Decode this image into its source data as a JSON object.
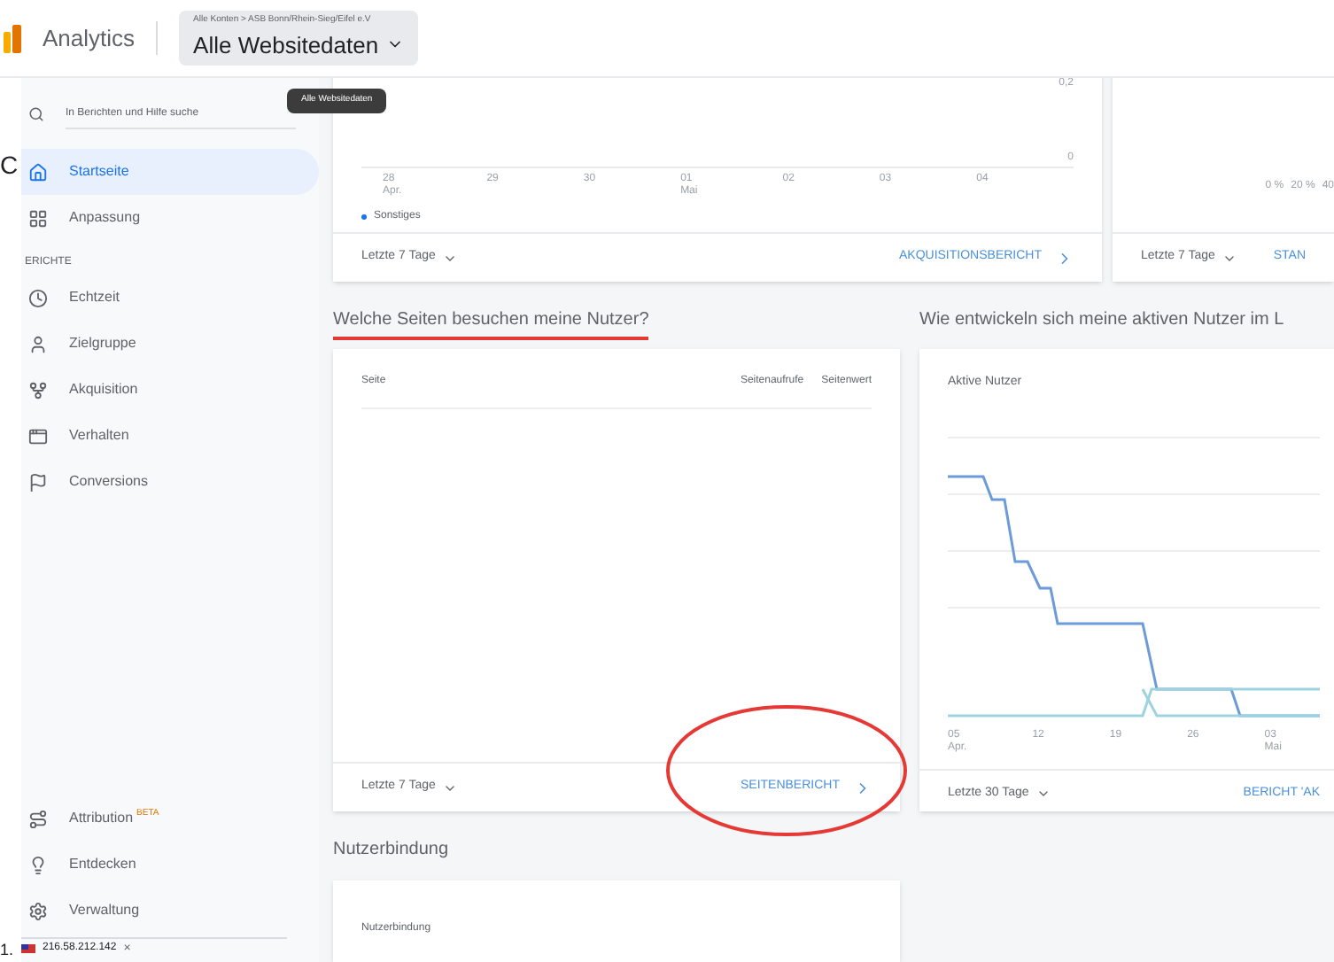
{
  "edge_marks": [
    "C",
    "1."
  ],
  "header": {
    "logo_text": "Analytics",
    "breadcrumb": "Alle Konten > ASB Bonn/Rhein-Sieg/Eifel e.V",
    "property": "Alle Websitedaten"
  },
  "tooltip": "Alle Websitedaten",
  "sidebar": {
    "search": {
      "placeholder": "In Berichten und Hilfe suche"
    },
    "top_items": [
      {
        "label": "Startseite",
        "selected": true
      },
      {
        "label": "Anpassung",
        "selected": false
      }
    ],
    "section_label": "ERICHTE",
    "report_items": [
      {
        "label": "Echtzeit",
        "selected": false
      },
      {
        "label": "Zielgruppe",
        "selected": false
      },
      {
        "label": "Akquisition",
        "selected": false
      },
      {
        "label": "Verhalten",
        "selected": false
      },
      {
        "label": "Conversions",
        "selected": false
      }
    ],
    "bottom_items": [
      {
        "label": "Attribution",
        "badge": "BETA",
        "selected": false
      },
      {
        "label": "Entdecken",
        "selected": false
      },
      {
        "label": "Verwaltung",
        "selected": false
      }
    ],
    "status_chip": {
      "text": "216.58.212.142",
      "close": "×"
    }
  },
  "top_cards": [
    {
      "y_labels": [
        "0,2",
        "0"
      ],
      "x_labels": [
        [
          "28",
          "Apr."
        ],
        [
          "29"
        ],
        [
          "30"
        ],
        [
          "01",
          "Mai"
        ],
        [
          "02"
        ],
        [
          "03"
        ],
        [
          "04"
        ]
      ],
      "legend": "Sonstiges",
      "range": "Letzte 7 Tage",
      "link": "AKQUISITIONSBERICHT"
    },
    {
      "x_labels": [
        [
          "0 %"
        ],
        [
          "20 %"
        ],
        [
          "40"
        ]
      ],
      "range": "Letzte 7 Tage",
      "link": "STAN"
    }
  ],
  "sections": [
    {
      "heading": "Welche Seiten besuchen meine Nutzer?",
      "annotated": true,
      "card": {
        "kind": "table",
        "columns": [
          "Seite",
          "Seitenaufrufe",
          "Seitenwert"
        ],
        "range": "Letzte 7 Tage",
        "link": "SEITENBERICHT",
        "circled": true
      }
    },
    {
      "heading": "Wie entwickeln sich meine aktiven Nutzer im L",
      "annotated": false,
      "card": {
        "kind": "chart",
        "title": "Aktive Nutzer",
        "x_labels": [
          [
            "05",
            "Apr."
          ],
          [
            "12"
          ],
          [
            "19"
          ],
          [
            "26"
          ],
          [
            "03",
            "Mai"
          ]
        ],
        "range": "Letzte 30 Tage",
        "link": "BERICHT 'AK",
        "circled": false
      }
    }
  ],
  "retention": {
    "heading": "Nutzerbindung",
    "card_title": "Nutzerbindung"
  }
}
